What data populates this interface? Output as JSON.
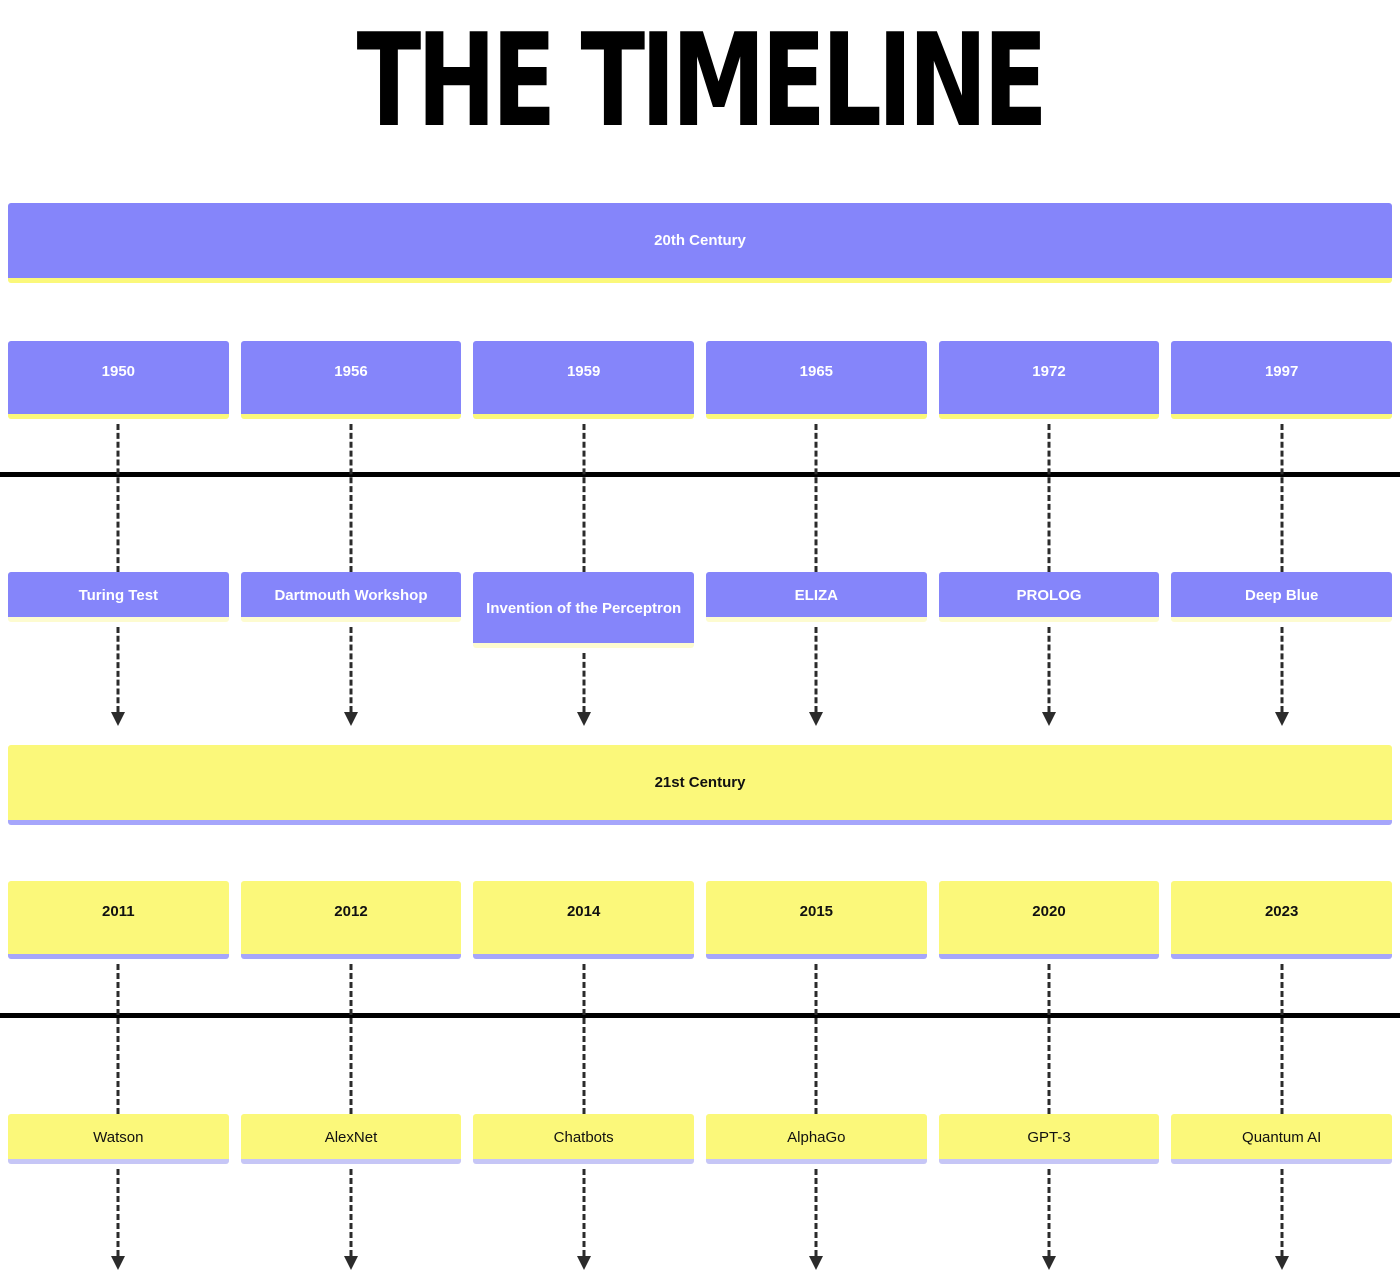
{
  "title": "THE TIMELINE",
  "colors": {
    "purple": "#8585fa",
    "yellow": "#fbf87a",
    "text_light": "#ffffff",
    "text_dark": "#111111",
    "separator": "#000000",
    "connector": "#2b2b2b"
  },
  "sections": [
    {
      "banner_label": "20th Century",
      "theme": "purple",
      "years": [
        "1950",
        "1956",
        "1959",
        "1965",
        "1972",
        "1997"
      ],
      "events": [
        "Turing Test",
        "Dartmouth Workshop",
        "Invention of the Perceptron",
        "ELIZA",
        "PROLOG",
        "Deep Blue"
      ]
    },
    {
      "banner_label": "21st Century",
      "theme": "yellow",
      "years": [
        "2011",
        "2012",
        "2014",
        "2015",
        "2020",
        "2023"
      ],
      "events": [
        "Watson",
        "AlexNet",
        "Chatbots",
        "AlphaGo",
        "GPT-3",
        "Quantum AI"
      ]
    }
  ]
}
